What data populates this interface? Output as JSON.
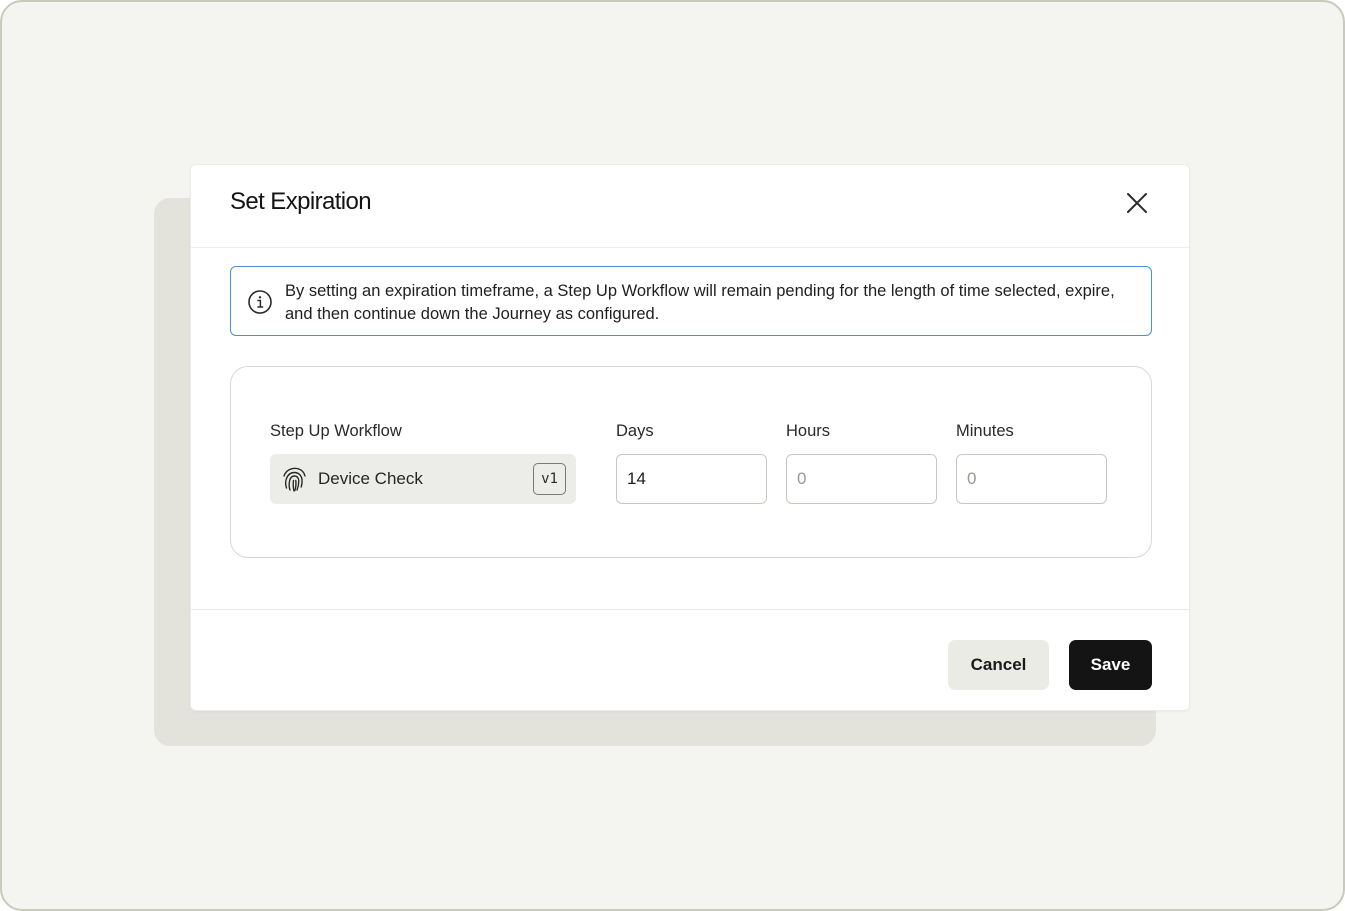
{
  "modal": {
    "title": "Set Expiration",
    "close_icon": "close-icon"
  },
  "info": {
    "icon": "info-icon",
    "text": "By setting an expiration timeframe, a Step Up Workflow will remain pending for the length of time selected, expire, and then continue down the Journey as configured."
  },
  "form": {
    "workflow": {
      "label": "Step Up Workflow",
      "icon": "fingerprint-icon",
      "name": "Device Check",
      "version": "v1"
    },
    "days": {
      "label": "Days",
      "value": "14",
      "placeholder": "0"
    },
    "hours": {
      "label": "Hours",
      "value": "",
      "placeholder": "0"
    },
    "minutes": {
      "label": "Minutes",
      "value": "",
      "placeholder": "0"
    }
  },
  "footer": {
    "cancel_label": "Cancel",
    "save_label": "Save"
  },
  "colors": {
    "accent_border": "#4a90d9",
    "primary_button": "#141414",
    "secondary_button": "#ebebe6",
    "page_background": "#f4f4f1"
  }
}
